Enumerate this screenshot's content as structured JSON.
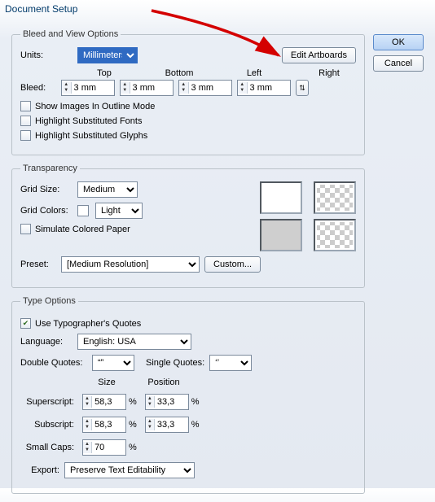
{
  "title": "Document Setup",
  "ok_label": "OK",
  "cancel_label": "Cancel",
  "bleed": {
    "legend": "Bleed and View Options",
    "units_label": "Units:",
    "units_value": "Millimeters",
    "edit_artboards_label": "Edit Artboards",
    "header_top": "Top",
    "header_bottom": "Bottom",
    "header_left": "Left",
    "header_right": "Right",
    "bleed_label": "Bleed:",
    "bleed_top": "3 mm",
    "bleed_bottom": "3 mm",
    "bleed_left": "3 mm",
    "bleed_right": "3 mm",
    "show_outline_label": "Show Images In Outline Mode",
    "hilite_fonts_label": "Highlight Substituted Fonts",
    "hilite_glyphs_label": "Highlight Substituted Glyphs"
  },
  "trans": {
    "legend": "Transparency",
    "grid_size_label": "Grid Size:",
    "grid_size_value": "Medium",
    "grid_colors_label": "Grid Colors:",
    "grid_colors_value": "Light",
    "sim_paper_label": "Simulate Colored Paper",
    "preset_label": "Preset:",
    "preset_value": "[Medium Resolution]",
    "custom_label": "Custom..."
  },
  "type": {
    "legend": "Type Options",
    "typographers_quotes_label": "Use Typographer's Quotes",
    "typographers_quotes_checked": true,
    "language_label": "Language:",
    "language_value": "English: USA",
    "dq_label": "Double Quotes:",
    "dq_value": "“”",
    "sq_label": "Single Quotes:",
    "sq_value": "‘’",
    "size_header": "Size",
    "position_header": "Position",
    "superscript_label": "Superscript:",
    "superscript_size": "58,3",
    "superscript_pos": "33,3",
    "subscript_label": "Subscript:",
    "subscript_size": "58,3",
    "subscript_pos": "33,3",
    "smallcaps_label": "Small Caps:",
    "smallcaps_value": "70",
    "export_label": "Export:",
    "export_value": "Preserve Text Editability",
    "pct": "%"
  }
}
